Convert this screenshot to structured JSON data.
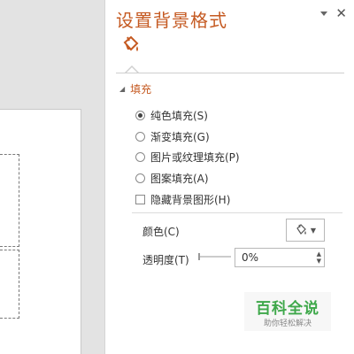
{
  "pane": {
    "title": "设置背景格式",
    "active_tab_icon": "paint-bucket-icon",
    "accent_color": "#c55a22"
  },
  "fill_section": {
    "header": "填充",
    "options": [
      {
        "label": "纯色填充(S)",
        "selected": true
      },
      {
        "label": "渐变填充(G)",
        "selected": false
      },
      {
        "label": "图片或纹理填充(P)",
        "selected": false
      },
      {
        "label": "图案填充(A)",
        "selected": false
      }
    ],
    "hide_bg_graphics": {
      "label": "隐藏背景图形(H)",
      "checked": false
    },
    "color_label": "颜色(C)",
    "transparency_label": "透明度(T)",
    "transparency_value": "0%"
  },
  "watermark": {
    "main": "百科全说",
    "sub": "助你轻松解决"
  }
}
